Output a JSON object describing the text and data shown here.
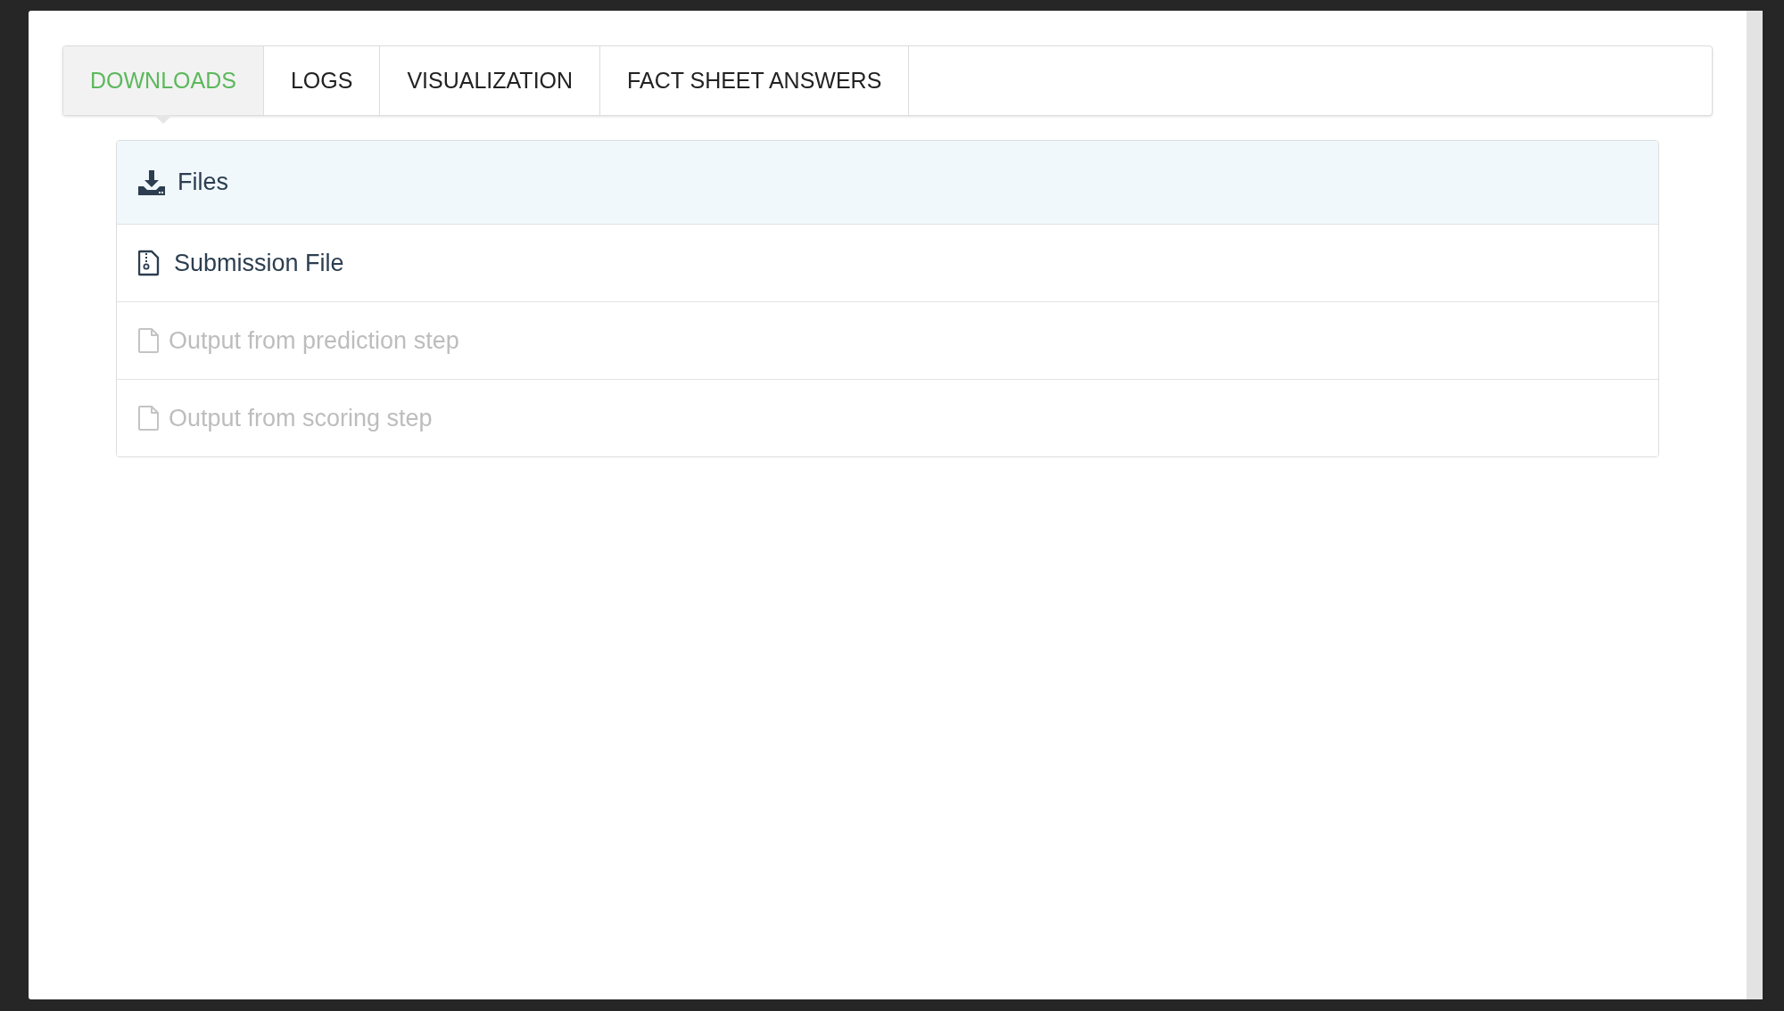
{
  "tabs": [
    {
      "label": "DOWNLOADS",
      "selected": true
    },
    {
      "label": "LOGS",
      "selected": false
    },
    {
      "label": "VISUALIZATION",
      "selected": false
    },
    {
      "label": "FACT SHEET ANSWERS",
      "selected": false
    }
  ],
  "downloads": [
    {
      "kind": "header",
      "label": "Files",
      "disabled": false
    },
    {
      "kind": "archive",
      "label": "Submission File",
      "disabled": false
    },
    {
      "kind": "file",
      "label": "Output from prediction step",
      "disabled": true
    },
    {
      "kind": "file",
      "label": "Output from scoring step",
      "disabled": true
    }
  ]
}
